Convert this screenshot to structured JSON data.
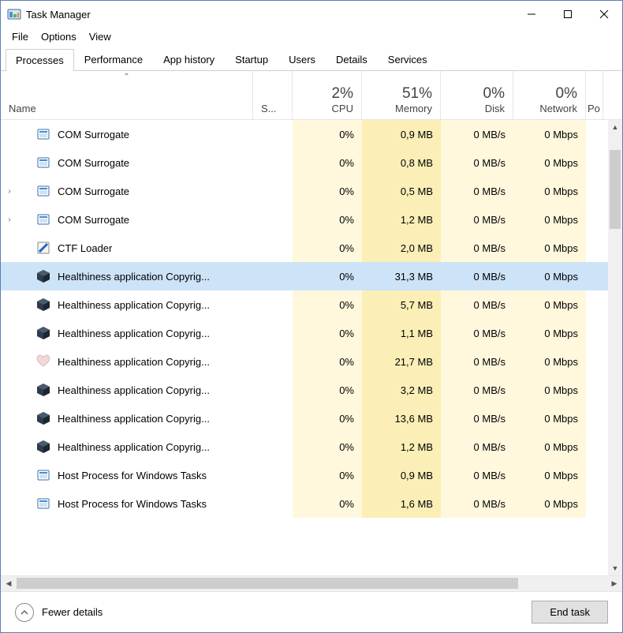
{
  "window": {
    "title": "Task Manager"
  },
  "menu": {
    "file": "File",
    "options": "Options",
    "view": "View"
  },
  "tabs": {
    "processes": "Processes",
    "performance": "Performance",
    "apphistory": "App history",
    "startup": "Startup",
    "users": "Users",
    "details": "Details",
    "services": "Services"
  },
  "columns": {
    "name": "Name",
    "status": "S...",
    "cpu": {
      "pct": "2%",
      "label": "CPU"
    },
    "memory": {
      "pct": "51%",
      "label": "Memory"
    },
    "disk": {
      "pct": "0%",
      "label": "Disk"
    },
    "network": {
      "pct": "0%",
      "label": "Network"
    },
    "po": "Po"
  },
  "rows": [
    {
      "expand": "",
      "icon": "win",
      "name": "COM Surrogate",
      "cpu": "0%",
      "mem": "0,9 MB",
      "disk": "0 MB/s",
      "net": "0 Mbps",
      "selected": false
    },
    {
      "expand": "",
      "icon": "win",
      "name": "COM Surrogate",
      "cpu": "0%",
      "mem": "0,8 MB",
      "disk": "0 MB/s",
      "net": "0 Mbps",
      "selected": false
    },
    {
      "expand": "›",
      "icon": "win",
      "name": "COM Surrogate",
      "cpu": "0%",
      "mem": "0,5 MB",
      "disk": "0 MB/s",
      "net": "0 Mbps",
      "selected": false
    },
    {
      "expand": "›",
      "icon": "win",
      "name": "COM Surrogate",
      "cpu": "0%",
      "mem": "1,2 MB",
      "disk": "0 MB/s",
      "net": "0 Mbps",
      "selected": false
    },
    {
      "expand": "",
      "icon": "ctf",
      "name": "CTF Loader",
      "cpu": "0%",
      "mem": "2,0 MB",
      "disk": "0 MB/s",
      "net": "0 Mbps",
      "selected": false
    },
    {
      "expand": "",
      "icon": "cube",
      "name": "Healthiness application Copyrig...",
      "cpu": "0%",
      "mem": "31,3 MB",
      "disk": "0 MB/s",
      "net": "0 Mbps",
      "selected": true
    },
    {
      "expand": "",
      "icon": "cube",
      "name": "Healthiness application Copyrig...",
      "cpu": "0%",
      "mem": "5,7 MB",
      "disk": "0 MB/s",
      "net": "0 Mbps",
      "selected": false
    },
    {
      "expand": "",
      "icon": "cube",
      "name": "Healthiness application Copyrig...",
      "cpu": "0%",
      "mem": "1,1 MB",
      "disk": "0 MB/s",
      "net": "0 Mbps",
      "selected": false
    },
    {
      "expand": "",
      "icon": "heart",
      "name": "Healthiness application Copyrig...",
      "cpu": "0%",
      "mem": "21,7 MB",
      "disk": "0 MB/s",
      "net": "0 Mbps",
      "selected": false
    },
    {
      "expand": "",
      "icon": "cube",
      "name": "Healthiness application Copyrig...",
      "cpu": "0%",
      "mem": "3,2 MB",
      "disk": "0 MB/s",
      "net": "0 Mbps",
      "selected": false
    },
    {
      "expand": "",
      "icon": "cube",
      "name": "Healthiness application Copyrig...",
      "cpu": "0%",
      "mem": "13,6 MB",
      "disk": "0 MB/s",
      "net": "0 Mbps",
      "selected": false
    },
    {
      "expand": "",
      "icon": "cube",
      "name": "Healthiness application Copyrig...",
      "cpu": "0%",
      "mem": "1,2 MB",
      "disk": "0 MB/s",
      "net": "0 Mbps",
      "selected": false
    },
    {
      "expand": "",
      "icon": "win",
      "name": "Host Process for Windows Tasks",
      "cpu": "0%",
      "mem": "0,9 MB",
      "disk": "0 MB/s",
      "net": "0 Mbps",
      "selected": false
    },
    {
      "expand": "",
      "icon": "win",
      "name": "Host Process for Windows Tasks",
      "cpu": "0%",
      "mem": "1,6 MB",
      "disk": "0 MB/s",
      "net": "0 Mbps",
      "selected": false
    }
  ],
  "footer": {
    "fewer": "Fewer details",
    "endtask": "End task"
  }
}
